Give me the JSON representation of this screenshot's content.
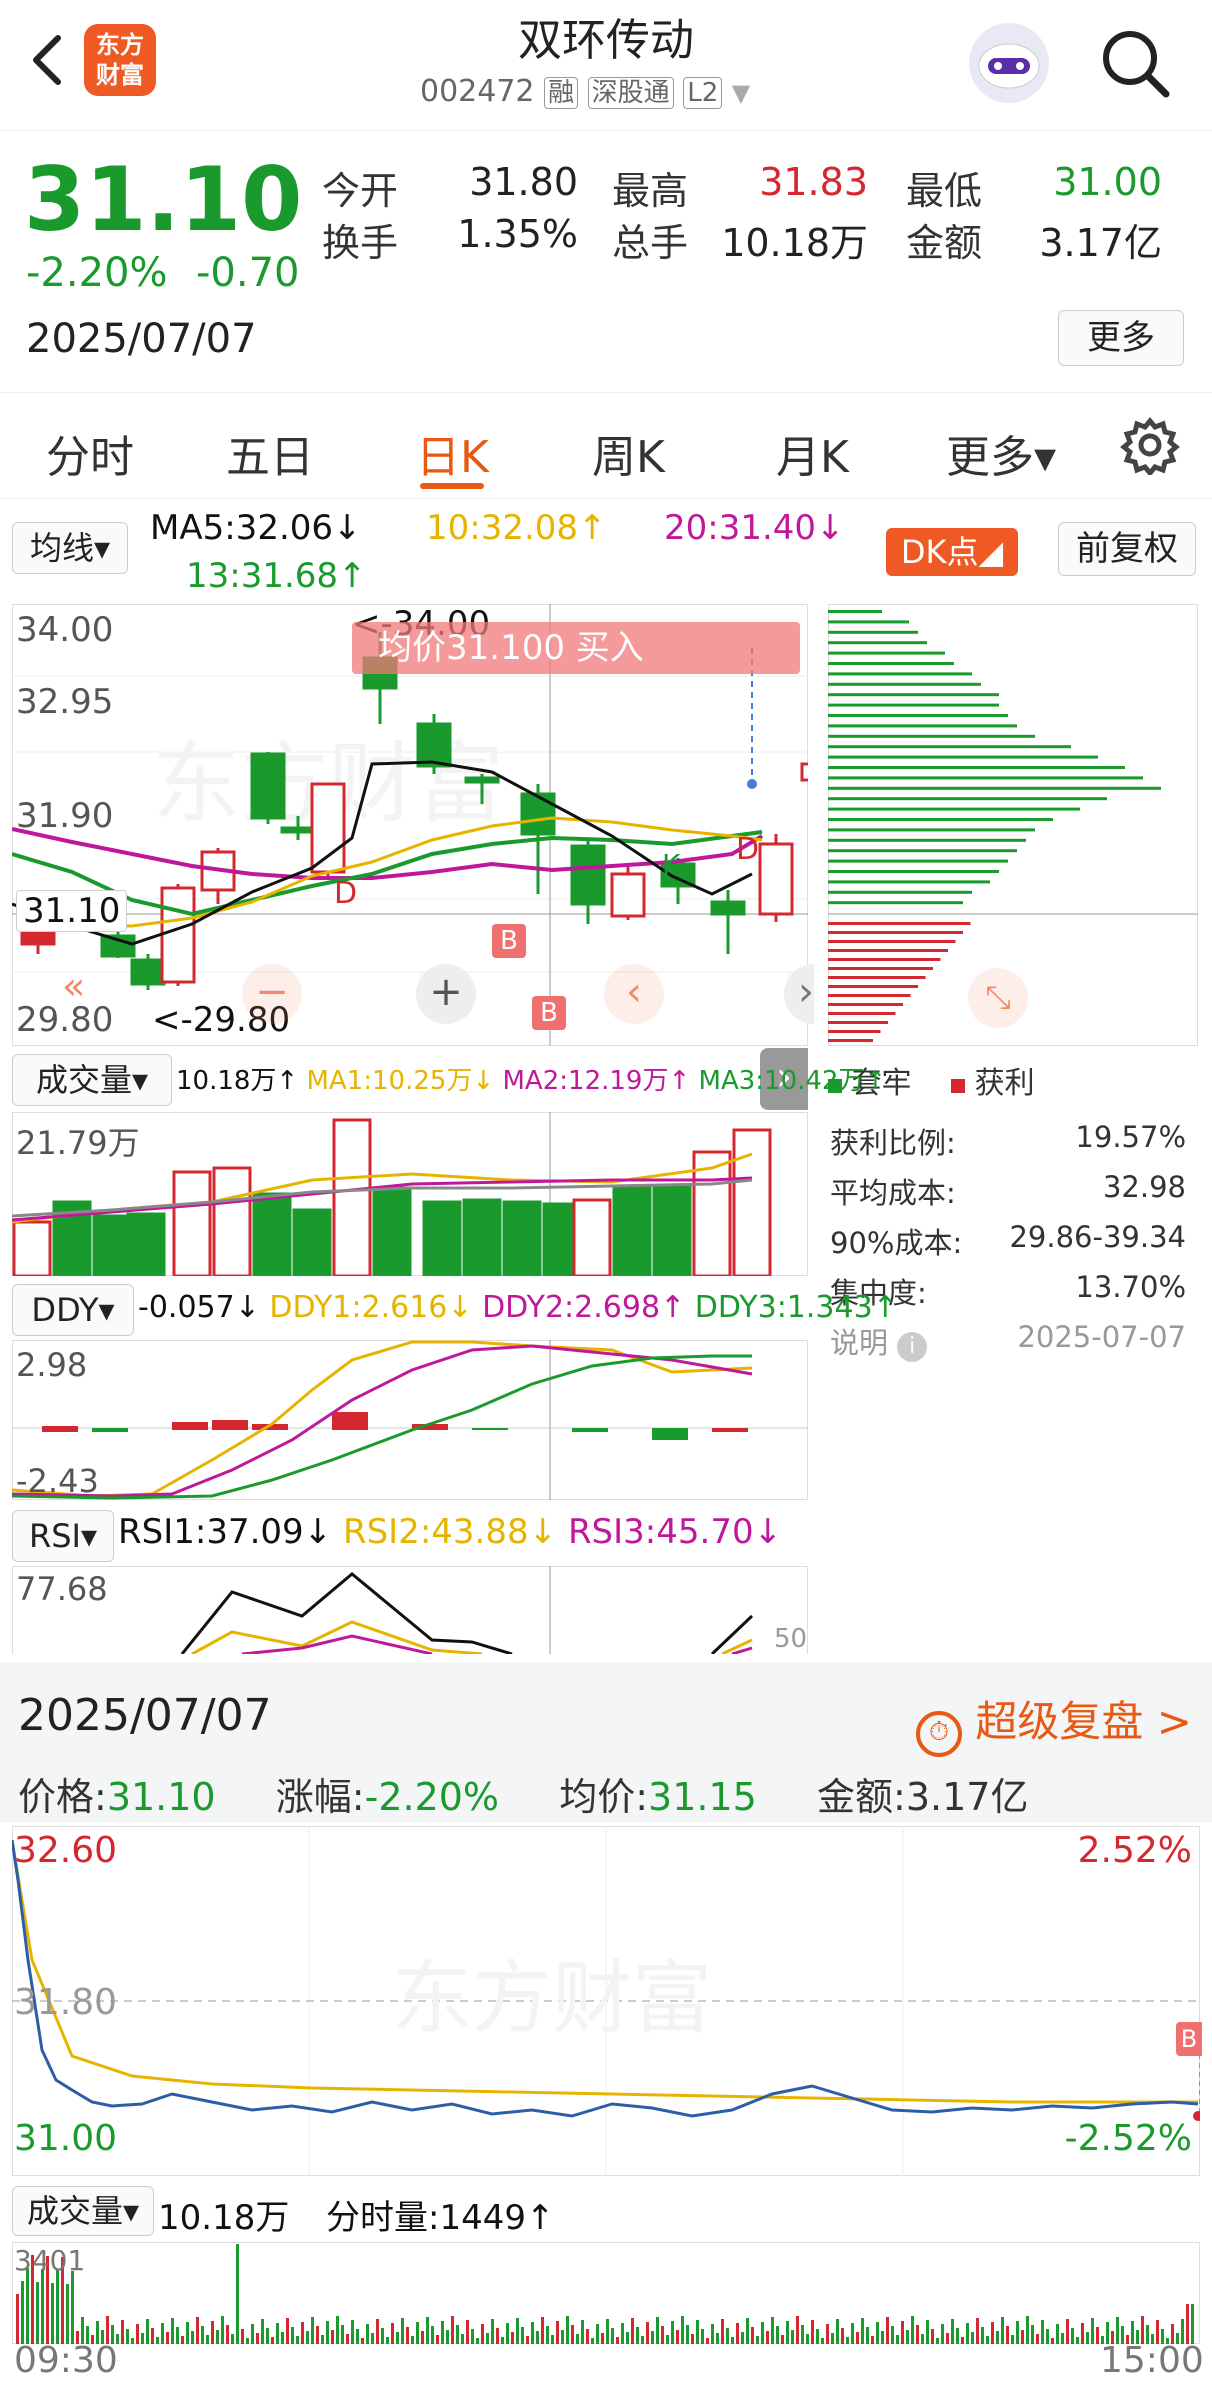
{
  "header": {
    "title": "双环传动",
    "code": "002472",
    "tags": [
      "融",
      "深股通",
      "L2"
    ],
    "logo_text": [
      "东方",
      "财富"
    ],
    "back_icon": "chevron-left-icon",
    "search_icon": "search-icon",
    "avatar_icon": "robot-avatar-icon"
  },
  "quote": {
    "price": "31.10",
    "change_pct": "-2.20%",
    "change": "-0.70",
    "date": "2025/07/07",
    "more_label": "更多",
    "stats": [
      {
        "label": "今开",
        "value": "31.80",
        "color": "dark"
      },
      {
        "label": "最高",
        "value": "31.83",
        "color": "red"
      },
      {
        "label": "最低",
        "value": "31.00",
        "color": "green"
      },
      {
        "label": "换手",
        "value": "1.35%",
        "color": "dark"
      },
      {
        "label": "总手",
        "value": "10.18万",
        "color": "dark"
      },
      {
        "label": "金额",
        "value": "3.17亿",
        "color": "dark"
      }
    ]
  },
  "tabs": [
    {
      "label": "分时",
      "active": false
    },
    {
      "label": "五日",
      "active": false
    },
    {
      "label": "日K",
      "active": true
    },
    {
      "label": "周K",
      "active": false
    },
    {
      "label": "月K",
      "active": false
    },
    {
      "label": "更多▾",
      "active": false
    }
  ],
  "settings_icon": "gear-icon",
  "ma_bar": {
    "selector": "均线▾",
    "ma5": "MA5:32.06↓",
    "ma10": "10:32.08↑",
    "ma20": "20:31.40↓",
    "ma13": "13:31.68↑",
    "dk_button": "DK点◢",
    "fq_button": "前复权"
  },
  "kline": {
    "y_labels": [
      "34.00",
      "32.95",
      "31.90",
      "29.80"
    ],
    "current_label": "31.10",
    "high_marker": "34.00",
    "low_marker": "29.80",
    "banner": "均价31.100  买入",
    "b_marker": "B",
    "d_marker": "D",
    "k_marker": "K",
    "colors": {
      "up": "#d3282f",
      "down": "#1a9a2c",
      "ma5": "#111111",
      "ma10": "#e6b400",
      "ma20": "#c0189a",
      "ma13": "#1a9a2c"
    }
  },
  "chip": {
    "legend": [
      {
        "label": "套牢",
        "color": "#1a9a2c"
      },
      {
        "label": "获利",
        "color": "#d3282f"
      }
    ],
    "rows": [
      {
        "label": "获利比例:",
        "value": "19.57%"
      },
      {
        "label": "平均成本:",
        "value": "32.98"
      },
      {
        "label": "90%成本:",
        "value": "29.86-39.34"
      },
      {
        "label": "集中度:",
        "value": "13.70%"
      }
    ],
    "note_label": "说明",
    "note_date": "2025-07-07"
  },
  "volume_bar": {
    "selector": "成交量▾",
    "vol": "10.18万↑",
    "ma1": "MA1:10.25万↓",
    "ma2": "MA2:12.19万↑",
    "ma3": "MA3:10.42万↑",
    "max_label": "21.79万"
  },
  "ddy_bar": {
    "selector": "DDY▾",
    "ddy": "-0.057↓",
    "ddy1": "DDY1:2.616↓",
    "ddy2": "DDY2:2.698↑",
    "ddy3": "DDY3:1.343↑",
    "top": "2.98",
    "bottom": "-2.43"
  },
  "rsi_bar": {
    "selector": "RSI▾",
    "rsi1": "RSI1:37.09↓",
    "rsi2": "RSI2:43.88↓",
    "rsi3": "RSI3:45.70↓",
    "top": "77.68",
    "mid": "50"
  },
  "intraday": {
    "date": "2025/07/07",
    "replay_label": "超级复盘 >",
    "price_label": "价格:",
    "price": "31.10",
    "chg_label": "涨幅:",
    "chg": "-2.20%",
    "avg_label": "均价:",
    "avg": "31.15",
    "amt_label": "金额:",
    "amt": "3.17亿",
    "y_top": "32.60",
    "y_mid": "31.80",
    "y_bottom": "31.00",
    "pct_top": "2.52%",
    "pct_bottom": "-2.52%",
    "vol_selector": "成交量▾",
    "vol_total": "10.18万",
    "vol_min": "分时量:1449↑",
    "vol_max": "3401",
    "time_start": "09:30",
    "time_end": "15:00",
    "watermark": "东方财富"
  }
}
